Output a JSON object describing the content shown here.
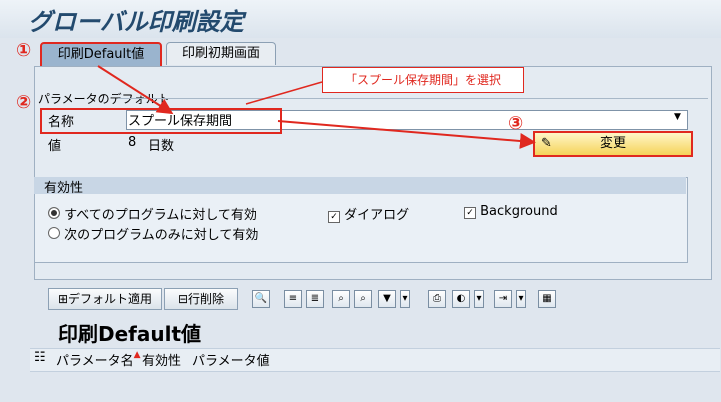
{
  "window": {
    "title": "グローバル印刷設定"
  },
  "tabs": [
    {
      "label": "印刷Default値",
      "active": true
    },
    {
      "label": "印刷初期画面",
      "active": false
    }
  ],
  "annotations": {
    "step1": "①",
    "step2": "②",
    "step3": "③",
    "callout": "「スプール保存期間」を選択"
  },
  "params": {
    "legend": "パラメータのデフォルト",
    "name_label": "名称",
    "name_value": "スプール保存期間",
    "value_label": "値",
    "value": "8",
    "value_unit": "日数",
    "change_button": "変更"
  },
  "validity": {
    "title": "有効性",
    "radio_all": "すべてのプログラムに対して有効",
    "radio_next": "次のプログラムのみに対して有効",
    "check_dialog": "ダイアログ",
    "check_background": "Background"
  },
  "toolbar": {
    "default_apply": "デフォルト適用",
    "delete_row": "行削除"
  },
  "section": {
    "title": "印刷Default値"
  },
  "table": {
    "col_param_name": "パラメータ名",
    "col_validity": "有効性",
    "col_param_value": "パラメータ値"
  },
  "colors": {
    "accent_red": "#e0281f",
    "tab_active": "#9ab4ce",
    "button_yellow": "#f5d35a"
  }
}
